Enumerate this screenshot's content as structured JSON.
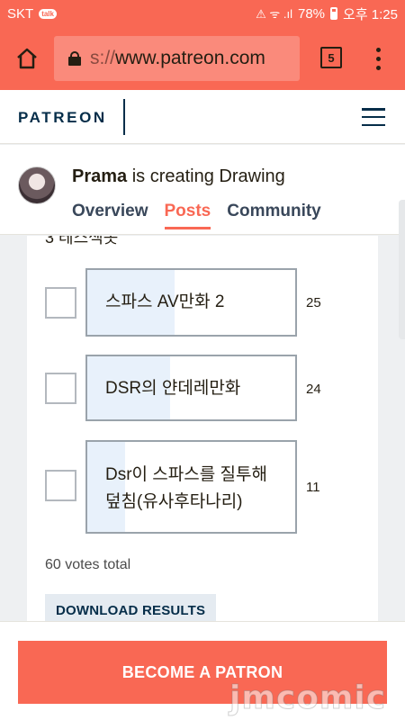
{
  "status_bar": {
    "carrier": "SKT",
    "talk_badge": "talk",
    "hd_badge": "HD Voice",
    "signal_text": "⚠ ᯤ .ıl",
    "battery": "78%",
    "time": "오후 1:25"
  },
  "browser": {
    "url_prefix": "s://",
    "url_main": "www.patreon.com",
    "tab_count": "5"
  },
  "site": {
    "logo": "PATREON"
  },
  "creator": {
    "name": "Prama",
    "tagline": " is creating Drawing",
    "tabs": [
      "Overview",
      "Posts",
      "Community"
    ],
    "active_tab": "Posts"
  },
  "poll": {
    "cut_heading": "3 테스섹못",
    "options": [
      {
        "label": "스파스 AV만화 2",
        "votes": "25",
        "share": 0.42
      },
      {
        "label": "DSR의 얀데레만화",
        "votes": "24",
        "share": 0.4
      },
      {
        "label": "Dsr이 스파스를 질투해 덮침(유사후타나리)",
        "votes": "11",
        "share": 0.18
      }
    ],
    "total": "60 votes total",
    "download_label": "DOWNLOAD RESULTS"
  },
  "cta": {
    "label": "BECOME A PATRON"
  },
  "watermark": "jmcomic"
}
